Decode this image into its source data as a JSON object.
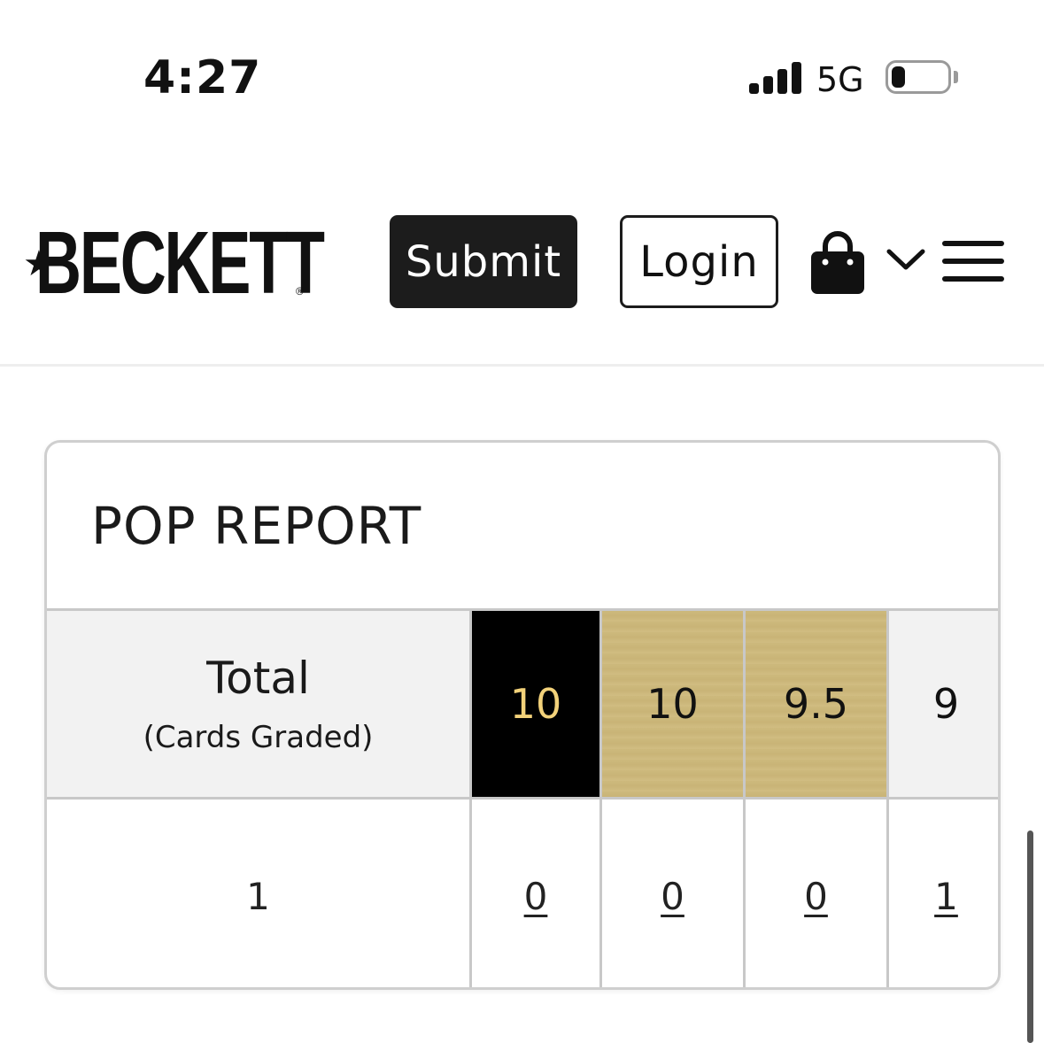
{
  "status_bar": {
    "time": "4:27",
    "network": "5G",
    "battery_level": 0.25,
    "signal_bars": 4
  },
  "header": {
    "logo_text": "BECKETT",
    "logo_registered": "®",
    "submit_label": "Submit",
    "login_label": "Login",
    "icons": [
      "shopping-bag-icon",
      "chevron-down-icon",
      "hamburger-menu-icon"
    ]
  },
  "pop_report": {
    "title": "POP REPORT",
    "total_label": "Total",
    "total_sublabel": "(Cards Graded)",
    "grades": [
      "10",
      "10",
      "9.5",
      "9"
    ],
    "total_value": "1",
    "counts": [
      "0",
      "0",
      "0",
      "1"
    ],
    "colors": {
      "black_label": "#000000",
      "black_label_text": "#f3d27a",
      "gold_label": "#cdb97c"
    }
  }
}
